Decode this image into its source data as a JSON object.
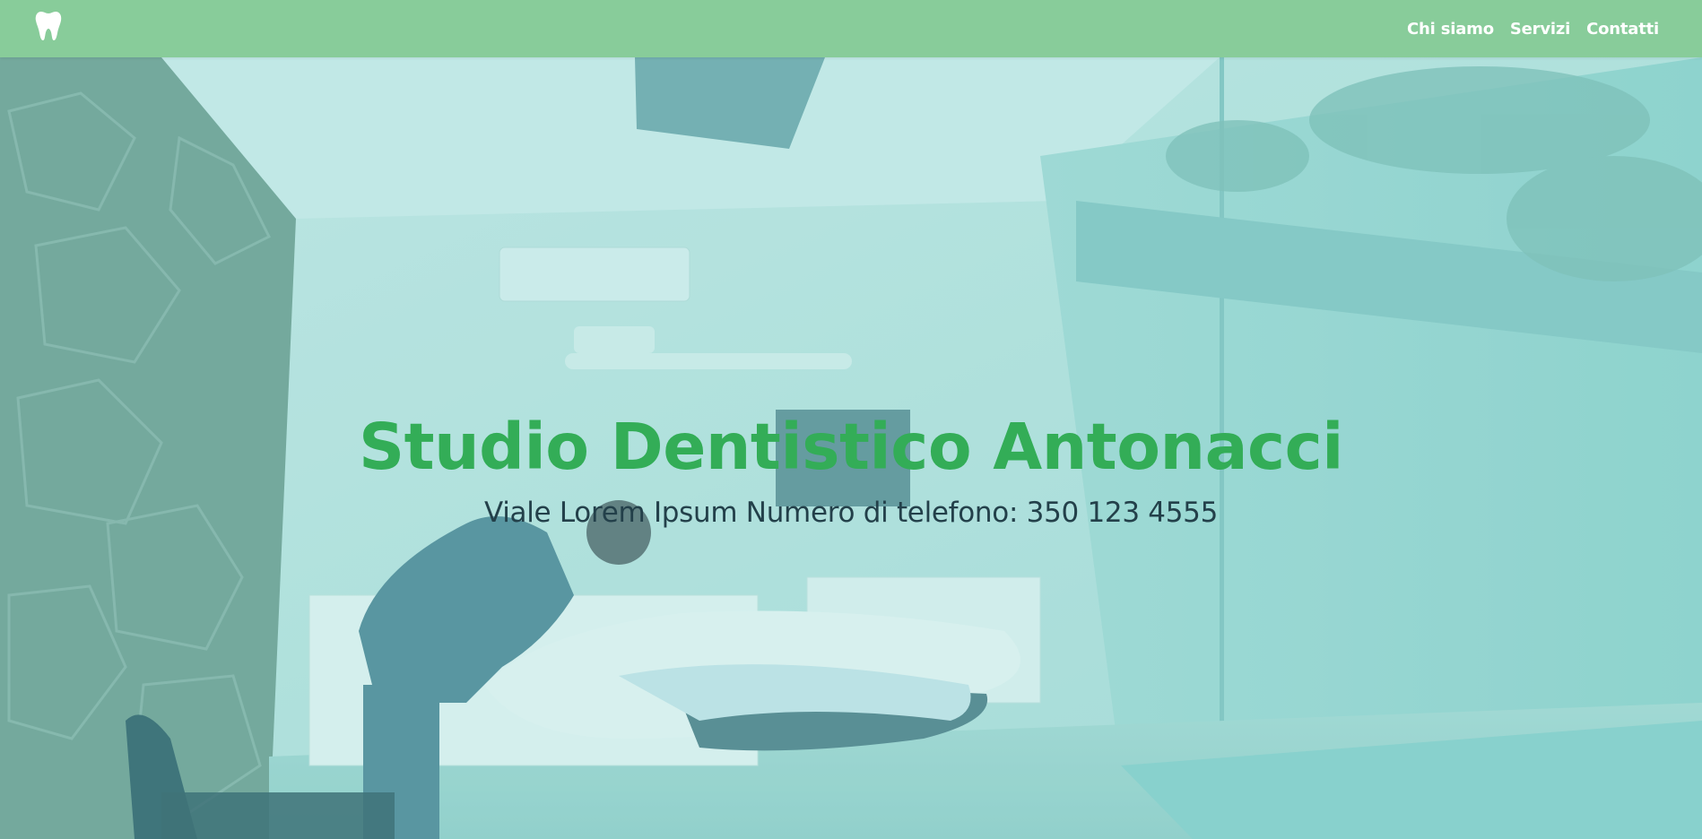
{
  "brand": {
    "logo_icon": "tooth-icon"
  },
  "nav": {
    "items": [
      {
        "label": "Chi siamo"
      },
      {
        "label": "Servizi"
      },
      {
        "label": "Contatti"
      }
    ]
  },
  "hero": {
    "title": "Studio Dentistico Antonacci",
    "subtitle": "Viale Lorem Ipsum Numero di telefono: 350 123 4555",
    "background_image": "dentist-examining-patient-photo"
  },
  "colors": {
    "navbar_bg": "#88cc9a",
    "nav_text": "#ffffff",
    "title_green": "#33ad57",
    "subtitle_text": "#23404a",
    "overlay_teal": "#9ed6d3"
  }
}
